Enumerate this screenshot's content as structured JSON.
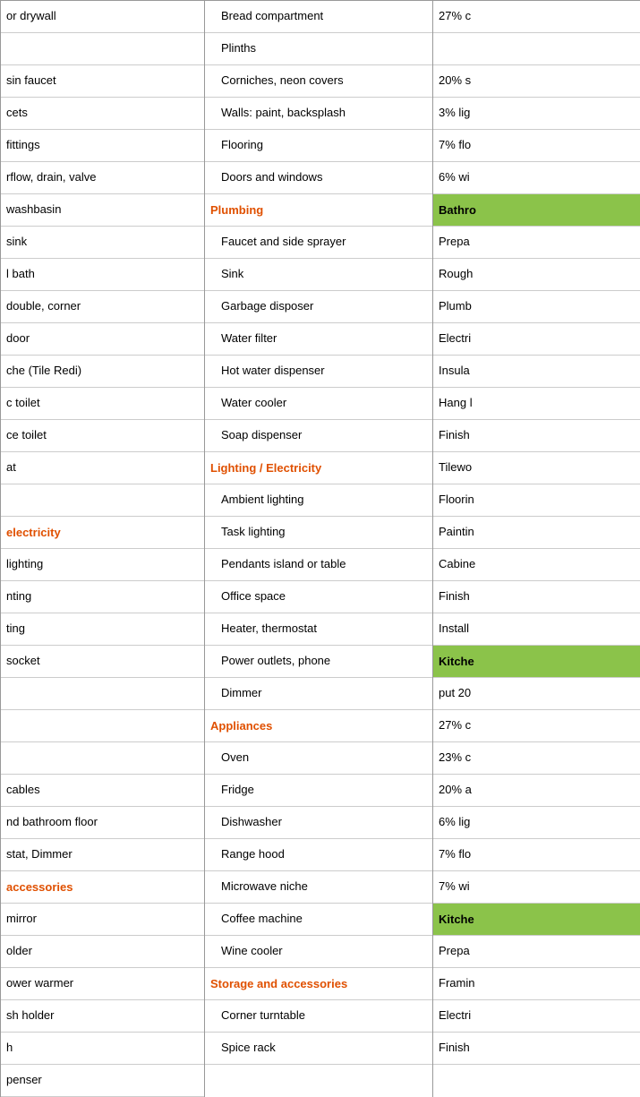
{
  "left_column": [
    {
      "text": "or drywall",
      "type": "normal",
      "indent": false
    },
    {
      "text": "",
      "type": "normal",
      "indent": false
    },
    {
      "text": "sin faucet",
      "type": "normal",
      "indent": false
    },
    {
      "text": "cets",
      "type": "normal",
      "indent": false
    },
    {
      "text": "fittings",
      "type": "normal",
      "indent": false
    },
    {
      "text": "rflow, drain, valve",
      "type": "normal",
      "indent": false
    },
    {
      "text": "washbasin",
      "type": "normal",
      "indent": false
    },
    {
      "text": "sink",
      "type": "normal",
      "indent": false
    },
    {
      "text": "l bath",
      "type": "normal",
      "indent": false
    },
    {
      "text": "double, corner",
      "type": "normal",
      "indent": false
    },
    {
      "text": "door",
      "type": "normal",
      "indent": false
    },
    {
      "text": "che (Tile Redi)",
      "type": "normal",
      "indent": false
    },
    {
      "text": "c toilet",
      "type": "normal",
      "indent": false
    },
    {
      "text": "ce toilet",
      "type": "normal",
      "indent": false
    },
    {
      "text": "at",
      "type": "normal",
      "indent": false
    },
    {
      "text": "",
      "type": "normal",
      "indent": false
    },
    {
      "text": "electricity",
      "type": "category",
      "indent": false
    },
    {
      "text": "lighting",
      "type": "normal",
      "indent": false
    },
    {
      "text": "nting",
      "type": "normal",
      "indent": false
    },
    {
      "text": "ting",
      "type": "normal",
      "indent": false
    },
    {
      "text": "socket",
      "type": "normal",
      "indent": false
    },
    {
      "text": "",
      "type": "normal",
      "indent": false
    },
    {
      "text": "",
      "type": "normal",
      "indent": false
    },
    {
      "text": "",
      "type": "normal",
      "indent": false
    },
    {
      "text": "cables",
      "type": "normal",
      "indent": false
    },
    {
      "text": "nd bathroom floor",
      "type": "normal",
      "indent": false
    },
    {
      "text": "stat, Dimmer",
      "type": "normal",
      "indent": false
    },
    {
      "text": "accessories",
      "type": "category",
      "indent": false
    },
    {
      "text": "mirror",
      "type": "normal",
      "indent": false
    },
    {
      "text": "older",
      "type": "normal",
      "indent": false
    },
    {
      "text": "ower warmer",
      "type": "normal",
      "indent": false
    },
    {
      "text": "sh holder",
      "type": "normal",
      "indent": false
    },
    {
      "text": "h",
      "type": "normal",
      "indent": false
    },
    {
      "text": "penser",
      "type": "normal",
      "indent": false
    }
  ],
  "mid_column": [
    {
      "text": "Bread compartment",
      "type": "normal",
      "indent": true
    },
    {
      "text": "Plinths",
      "type": "normal",
      "indent": true
    },
    {
      "text": "Corniches, neon covers",
      "type": "normal",
      "indent": true
    },
    {
      "text": "Walls: paint, backsplash",
      "type": "normal",
      "indent": true
    },
    {
      "text": "Flooring",
      "type": "normal",
      "indent": true
    },
    {
      "text": "Doors and windows",
      "type": "normal",
      "indent": true
    },
    {
      "text": "Plumbing",
      "type": "category",
      "indent": false
    },
    {
      "text": "Faucet and side sprayer",
      "type": "normal",
      "indent": true
    },
    {
      "text": "Sink",
      "type": "normal",
      "indent": true
    },
    {
      "text": "Garbage disposer",
      "type": "normal",
      "indent": true
    },
    {
      "text": "Water filter",
      "type": "normal",
      "indent": true
    },
    {
      "text": "Hot water dispenser",
      "type": "normal",
      "indent": true
    },
    {
      "text": "Water cooler",
      "type": "normal",
      "indent": true
    },
    {
      "text": "Soap dispenser",
      "type": "normal",
      "indent": true
    },
    {
      "text": "Lighting / Electricity",
      "type": "category",
      "indent": false
    },
    {
      "text": "Ambient lighting",
      "type": "normal",
      "indent": true
    },
    {
      "text": "Task lighting",
      "type": "normal",
      "indent": true
    },
    {
      "text": "Pendants island or table",
      "type": "normal",
      "indent": true
    },
    {
      "text": "Office space",
      "type": "normal",
      "indent": true
    },
    {
      "text": "Heater, thermostat",
      "type": "normal",
      "indent": true
    },
    {
      "text": "Power outlets, phone",
      "type": "normal",
      "indent": true
    },
    {
      "text": "Dimmer",
      "type": "normal",
      "indent": true
    },
    {
      "text": "Appliances",
      "type": "category",
      "indent": false
    },
    {
      "text": "Oven",
      "type": "normal",
      "indent": true
    },
    {
      "text": "Fridge",
      "type": "normal",
      "indent": true
    },
    {
      "text": "Dishwasher",
      "type": "normal",
      "indent": true
    },
    {
      "text": "Range hood",
      "type": "normal",
      "indent": true
    },
    {
      "text": "Microwave niche",
      "type": "normal",
      "indent": true
    },
    {
      "text": "Coffee machine",
      "type": "normal",
      "indent": true
    },
    {
      "text": "Wine cooler",
      "type": "normal",
      "indent": true
    },
    {
      "text": "Storage and accessories",
      "type": "category",
      "indent": false
    },
    {
      "text": "Corner turntable",
      "type": "normal",
      "indent": true
    },
    {
      "text": "Spice rack",
      "type": "normal",
      "indent": true
    }
  ],
  "right_column": [
    {
      "text": "27% c",
      "type": "normal"
    },
    {
      "text": "",
      "type": "normal"
    },
    {
      "text": "20% s",
      "type": "normal"
    },
    {
      "text": "3% lig",
      "type": "normal"
    },
    {
      "text": "7% flo",
      "type": "normal"
    },
    {
      "text": "6% wi",
      "type": "normal"
    },
    {
      "text": "Bathro",
      "type": "highlight"
    },
    {
      "text": "Prepa",
      "type": "normal"
    },
    {
      "text": "Rough",
      "type": "normal"
    },
    {
      "text": "Plumb",
      "type": "normal"
    },
    {
      "text": "Electri",
      "type": "normal"
    },
    {
      "text": "Insula",
      "type": "normal"
    },
    {
      "text": "Hang l",
      "type": "normal"
    },
    {
      "text": "Finish",
      "type": "normal"
    },
    {
      "text": "Tilewo",
      "type": "normal"
    },
    {
      "text": "Floorin",
      "type": "normal"
    },
    {
      "text": "Paintin",
      "type": "normal"
    },
    {
      "text": "Cabine",
      "type": "normal"
    },
    {
      "text": "Finish",
      "type": "normal"
    },
    {
      "text": "Install",
      "type": "normal"
    },
    {
      "text": "Kitche",
      "type": "highlight"
    },
    {
      "text": "put 20",
      "type": "normal"
    },
    {
      "text": "27% c",
      "type": "normal"
    },
    {
      "text": "23% c",
      "type": "normal"
    },
    {
      "text": "20% a",
      "type": "normal"
    },
    {
      "text": "6% lig",
      "type": "normal"
    },
    {
      "text": "7% flo",
      "type": "normal"
    },
    {
      "text": "7% wi",
      "type": "normal"
    },
    {
      "text": "Kitche",
      "type": "highlight"
    },
    {
      "text": "Prepa",
      "type": "normal"
    },
    {
      "text": "Framin",
      "type": "normal"
    },
    {
      "text": "Electri",
      "type": "normal"
    },
    {
      "text": "Finish",
      "type": "normal"
    }
  ]
}
